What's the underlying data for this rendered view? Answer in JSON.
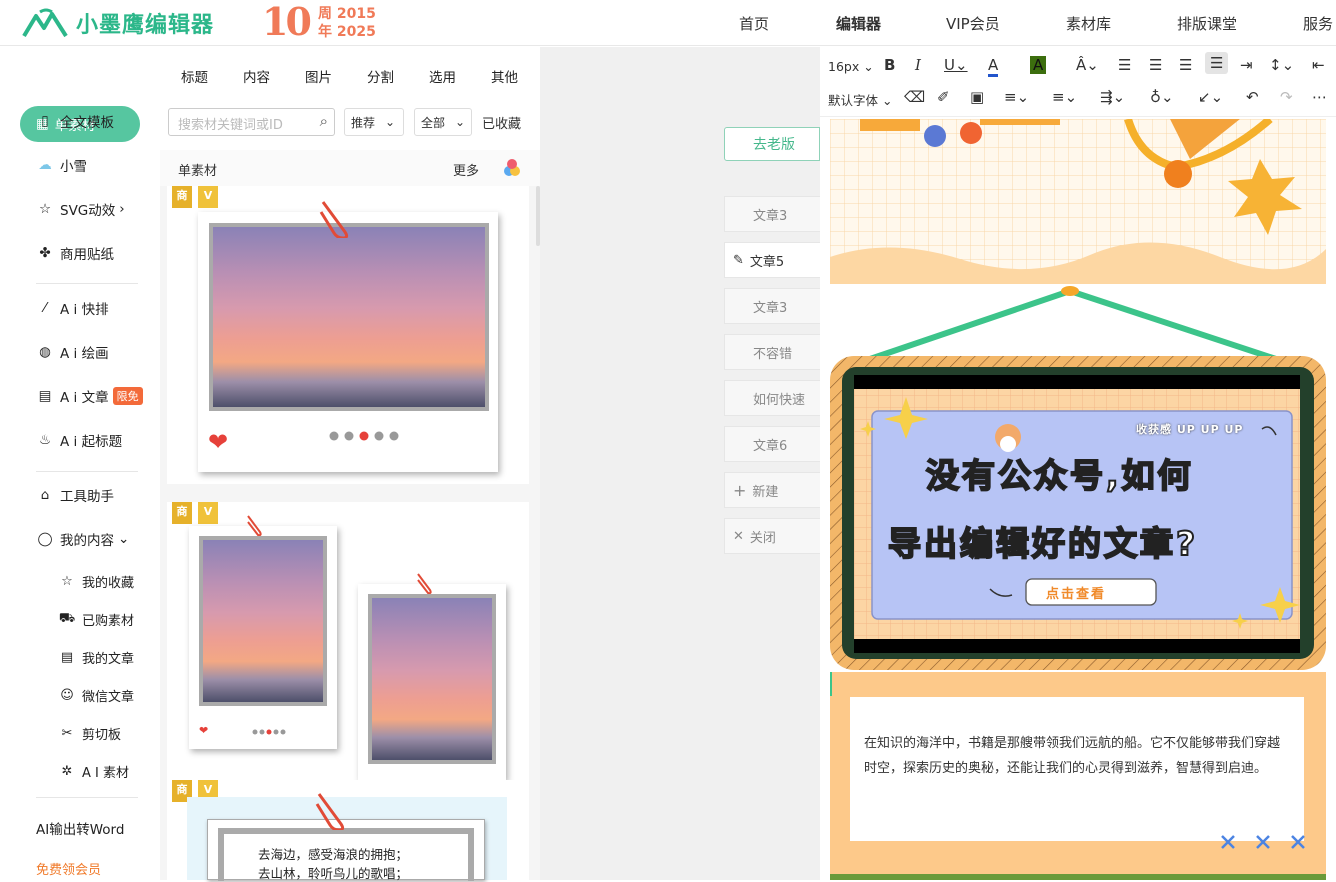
{
  "header": {
    "logo_text": "小墨鹰编辑器",
    "anniversary_number": "10",
    "anniversary_line1": "周 2015",
    "anniversary_line2": "年 2025",
    "nav": [
      "首页",
      "编辑器",
      "VIP会员",
      "素材库",
      "排版课堂",
      "服务"
    ]
  },
  "rail": {
    "active": "单素材",
    "items": [
      "全文模板",
      "小雪",
      "SVG动效",
      "商用贴纸",
      "A i 快排",
      "A i 绘画",
      "A i 文章",
      "A i 起标题",
      "工具助手",
      "我的内容"
    ],
    "ai_article_badge": "限免",
    "sub_items": [
      "我的收藏",
      "已购素材",
      "我的文章",
      "微信文章",
      "剪切板",
      "A I 素材"
    ],
    "word_export": "AI输出转Word",
    "free_vip": "免费领会员"
  },
  "panel": {
    "tabs": [
      "标题",
      "内容",
      "图片",
      "分割",
      "选用",
      "其他"
    ],
    "search_placeholder": "搜索材关键词或ID",
    "filter_sort": "推荐",
    "filter_scope": "全部",
    "favorited": "已收藏",
    "section_title": "单素材",
    "more": "更多",
    "tag_commercial": "商",
    "tag_vip": "V",
    "poem_line1": "去海边，感受海浪的拥抱；",
    "poem_line2": "去山林，聆听鸟儿的歌唱；"
  },
  "middle": {
    "old_version": "去老版",
    "articles": [
      "文章3",
      "文章5",
      "文章3",
      "不容错",
      "如何快速",
      "文章6"
    ],
    "new_label": "新建",
    "close_label": "关闭"
  },
  "toolbar": {
    "font_size": "16px",
    "font_family": "默认字体"
  },
  "canvas": {
    "banner_top_text": "收获感 UP UP UP",
    "banner_line1": "没有公众号,如何",
    "banner_line2": "导出编辑好的文章?",
    "banner_button": "点击查看",
    "body_text": "在知识的海洋中，书籍是那艘带领我们远航的船。它不仅能够带我们穿越时空，探索历史的奥秘，还能让我们的心灵得到滋养，智慧得到启迪。"
  },
  "colors": {
    "brand_green": "#2cb78a",
    "active_pill": "#56c6a0",
    "anniversary": "#f07a58",
    "canvas_peach": "#fdd7a3"
  }
}
